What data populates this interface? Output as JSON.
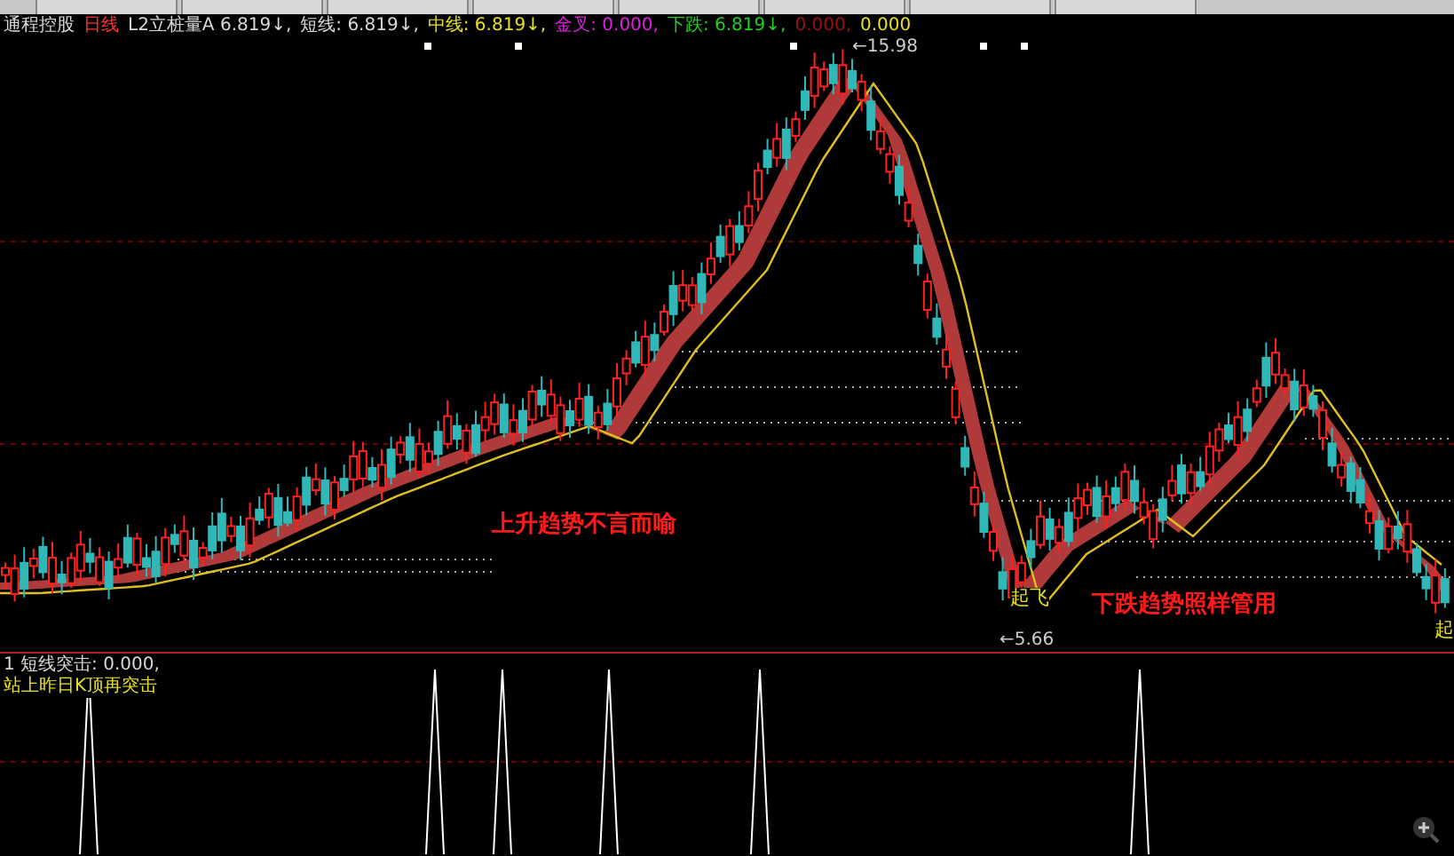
{
  "legend": [
    {
      "text": "通程控股",
      "color": "#d8d8d8"
    },
    {
      "text": "日线",
      "color": "#ff3030"
    },
    {
      "text": "L2立桩量A 6.819↓,",
      "color": "#d8d8d8"
    },
    {
      "text": "短线: 6.819↓,",
      "color": "#d8d8d8"
    },
    {
      "text": "中线: 6.819↓,",
      "color": "#e8e020"
    },
    {
      "text": "金叉: 0.000,",
      "color": "#e020e0"
    },
    {
      "text": "下跌: 6.819↓,",
      "color": "#20d020"
    },
    {
      "text": "0.000,",
      "color": "#a01010"
    },
    {
      "text": "0.000",
      "color": "#e8e020"
    }
  ],
  "price_labels": [
    {
      "kind": "high",
      "text": "←15.98"
    },
    {
      "kind": "low",
      "text": "←5.66"
    }
  ],
  "annotations": [
    {
      "kind": "caption",
      "text": "上升趋势不言而喻"
    },
    {
      "kind": "signal",
      "text": "起飞"
    },
    {
      "kind": "caption",
      "text": "下跌趋势照样管用"
    },
    {
      "kind": "signal",
      "text": "起"
    }
  ],
  "indicator": {
    "header": "1 短线突击: 0.000,",
    "signal_name": "站上昨日K顶再突击"
  }
}
